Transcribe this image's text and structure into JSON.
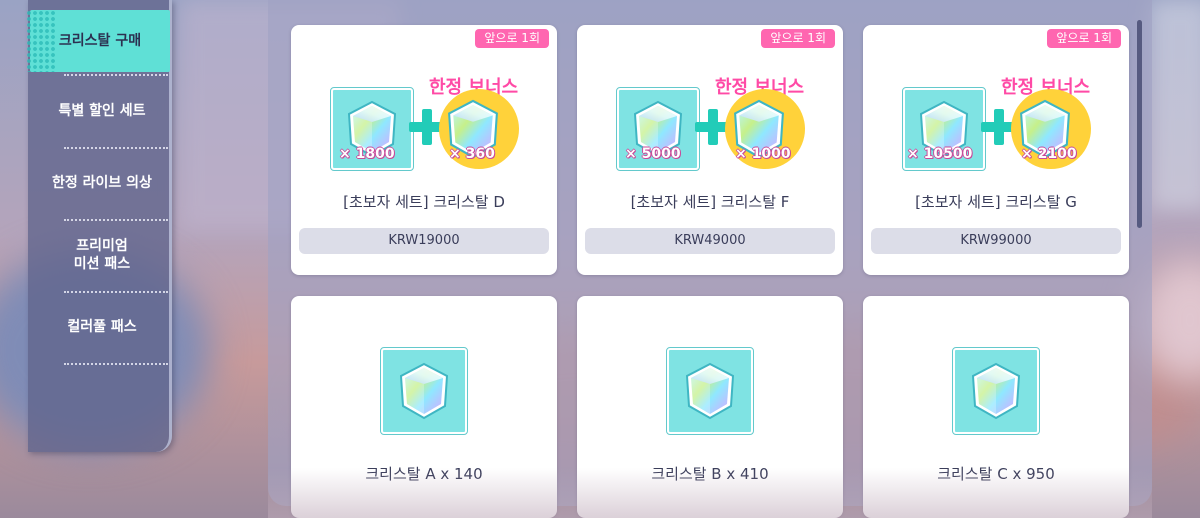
{
  "sidebar": {
    "items": [
      {
        "label": "크리스탈 구매",
        "active": true
      },
      {
        "label": "특별 할인 세트",
        "active": false
      },
      {
        "label": "한정 라이브 의상",
        "active": false
      },
      {
        "label": "프리미엄\n미션 패스",
        "active": false
      },
      {
        "label": "컬러풀 패스",
        "active": false
      }
    ]
  },
  "shop": {
    "bundles": [
      {
        "remaining": "앞으로 1회",
        "bonus_label": "한정 보너스",
        "main_qty": "× 1800",
        "bonus_qty": "× 360",
        "name": "[초보자 세트] 크리스탈 D",
        "price": "KRW19000"
      },
      {
        "remaining": "앞으로 1회",
        "bonus_label": "한정 보너스",
        "main_qty": "× 5000",
        "bonus_qty": "× 1000",
        "name": "[초보자 세트] 크리스탈 F",
        "price": "KRW49000"
      },
      {
        "remaining": "앞으로 1회",
        "bonus_label": "한정 보너스",
        "main_qty": "× 10500",
        "bonus_qty": "× 2100",
        "name": "[초보자 세트] 크리스탈 G",
        "price": "KRW99000"
      }
    ],
    "singles": [
      {
        "name": "크리스탈 A x 140"
      },
      {
        "name": "크리스탈 B x 410"
      },
      {
        "name": "크리스탈 C x 950"
      }
    ]
  },
  "colors": {
    "accent_teal": "#5fe0d6",
    "badge_pink": "#ff66b0",
    "bonus_pink": "#ff4aa6",
    "bonus_gold": "#ffd23a",
    "crystal_bg": "#7fe3e3"
  },
  "icons": {
    "crystal": "crystal-gem-icon",
    "plus": "plus-icon"
  }
}
